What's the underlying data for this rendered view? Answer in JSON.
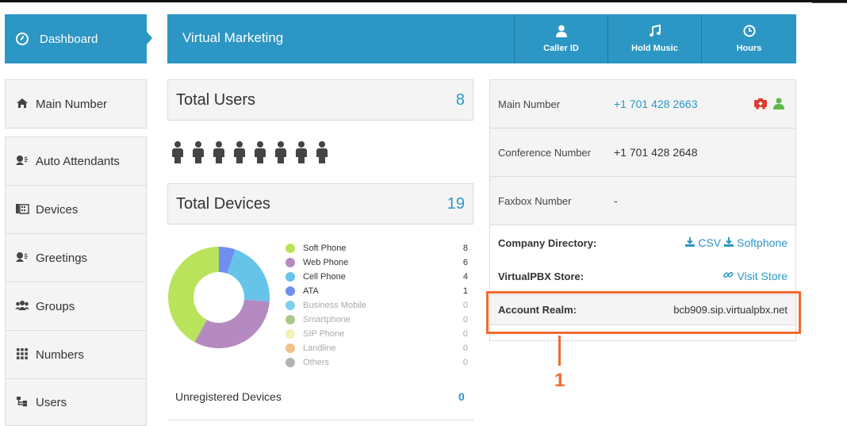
{
  "sidebar": {
    "dashboard": "Dashboard",
    "items": [
      {
        "label": "Main Number",
        "icon": "home-icon"
      },
      {
        "label": "Auto Attendants",
        "icon": "speaker-person-icon"
      },
      {
        "label": "Devices",
        "icon": "fax-icon"
      },
      {
        "label": "Greetings",
        "icon": "speaker-person-icon"
      },
      {
        "label": "Groups",
        "icon": "group-icon"
      },
      {
        "label": "Numbers",
        "icon": "grid-icon"
      },
      {
        "label": "Users",
        "icon": "sitemap-icon"
      }
    ]
  },
  "header": {
    "title": "Virtual Marketing",
    "buttons": [
      {
        "label": "Caller ID",
        "icon": "user-icon"
      },
      {
        "label": "Hold Music",
        "icon": "music-icon"
      },
      {
        "label": "Hours",
        "icon": "clock-icon"
      }
    ]
  },
  "totals": {
    "users_label": "Total Users",
    "users_count": "8",
    "devices_label": "Total Devices",
    "devices_count": "19"
  },
  "devices_legend": [
    {
      "label": "Soft Phone",
      "count": "8",
      "color": "#b9e35a"
    },
    {
      "label": "Web Phone",
      "count": "6",
      "color": "#b48ac0"
    },
    {
      "label": "Cell Phone",
      "count": "4",
      "color": "#66c4e8"
    },
    {
      "label": "ATA",
      "count": "1",
      "color": "#6f8ff0"
    },
    {
      "label": "Business Mobile",
      "count": "0",
      "color": "#7fd0ef"
    },
    {
      "label": "Smartphone",
      "count": "0",
      "color": "#a9c98a"
    },
    {
      "label": "SIP Phone",
      "count": "0",
      "color": "#f3f0b8"
    },
    {
      "label": "Landline",
      "count": "0",
      "color": "#f2c08a"
    },
    {
      "label": "Others",
      "count": "0",
      "color": "#b3b3b3"
    }
  ],
  "chart_data": {
    "type": "pie",
    "categories": [
      "Soft Phone",
      "Web Phone",
      "Cell Phone",
      "ATA",
      "Business Mobile",
      "Smartphone",
      "SIP Phone",
      "Landline",
      "Others"
    ],
    "values": [
      8,
      6,
      4,
      1,
      0,
      0,
      0,
      0,
      0
    ],
    "colors": [
      "#b9e35a",
      "#b48ac0",
      "#66c4e8",
      "#6f8ff0",
      "#7fd0ef",
      "#a9c98a",
      "#f3f0b8",
      "#f2c08a",
      "#b3b3b3"
    ],
    "title": "",
    "donut": true
  },
  "unregistered": {
    "label": "Unregistered Devices",
    "count": "0"
  },
  "info": {
    "main_number_label": "Main Number",
    "main_number": "+1 701 428 2663",
    "conference_label": "Conference Number",
    "conference_number": "+1 701 428 2648",
    "faxbox_label": "Faxbox Number",
    "faxbox_number": "-",
    "company_directory_label": "Company Directory:",
    "csv_link": "CSV",
    "softphone_link": "Softphone",
    "store_label": "VirtualPBX Store:",
    "store_link": "Visit Store",
    "realm_label": "Account Realm:",
    "realm_value": "bcb909.sip.virtualpbx.net"
  },
  "annotation": {
    "number": "1",
    "color": "#f26a2e"
  },
  "colors": {
    "accent": "#2c96c4",
    "panel": "#f4f4f4",
    "border": "#dcdcdc"
  }
}
